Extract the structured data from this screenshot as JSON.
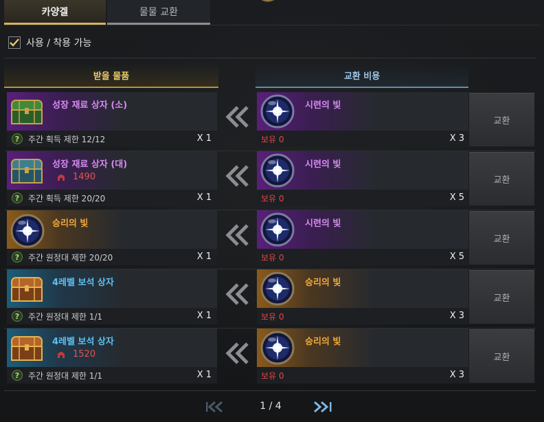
{
  "tabs": [
    {
      "label": "카양겔",
      "active": true
    },
    {
      "label": "물물 교환",
      "active": false
    }
  ],
  "filter": {
    "label": "사용 / 착용 가능",
    "checked": true
  },
  "headers": {
    "receive": "받을 물품",
    "cost": "교환 비용"
  },
  "rows": [
    {
      "item": {
        "name": "성장 재료 상자 (소)",
        "color": "purple",
        "icon": "green-chest-icon"
      },
      "limit": "주간 획득 제한 12/12",
      "qty": "X 1",
      "cost": {
        "name": "시련의 빛",
        "color": "purple",
        "icon": "trial-light-orb-icon",
        "owned": "보유 0",
        "qty": "X 3"
      },
      "button": "교환"
    },
    {
      "item": {
        "name": "성장 재료 상자 (대)",
        "color": "purple",
        "icon": "teal-chest-icon",
        "price": "1490"
      },
      "limit": "주간 획득 제한 20/20",
      "qty": "X 1",
      "cost": {
        "name": "시련의 빛",
        "color": "purple",
        "icon": "trial-light-orb-icon",
        "owned": "보유 0",
        "qty": "X 5"
      },
      "button": "교환"
    },
    {
      "item": {
        "name": "승리의 빛",
        "color": "orange",
        "icon": "victory-light-orb-icon"
      },
      "limit": "주간 원정대 제한 20/20",
      "qty": "X 1",
      "cost": {
        "name": "시련의 빛",
        "color": "purple",
        "icon": "trial-light-orb-icon",
        "owned": "보유 0",
        "qty": "X 5"
      },
      "button": "교환"
    },
    {
      "item": {
        "name": "4레벨 보석 상자",
        "color": "blue",
        "icon": "gem-chest-icon"
      },
      "limit": "주간 원정대 제한 1/1",
      "qty": "X 1",
      "cost": {
        "name": "승리의 빛",
        "color": "orange",
        "icon": "victory-light-orb-icon",
        "owned": "보유 0",
        "qty": "X 3"
      },
      "button": "교환"
    },
    {
      "item": {
        "name": "4레벨 보석 상자",
        "color": "blue",
        "icon": "gem-chest-icon",
        "price": "1520"
      },
      "limit": "주간 원정대 제한 1/1",
      "qty": "X 1",
      "cost": {
        "name": "승리의 빛",
        "color": "orange",
        "icon": "victory-light-orb-icon",
        "owned": "보유 0",
        "qty": "X 3"
      },
      "button": "교환"
    }
  ],
  "pager": {
    "text": "1 / 4"
  },
  "colors": {
    "gold_accent": "#d6b35b",
    "purple": "#d58af0",
    "orange": "#f0a93a",
    "blue": "#5ec0f0",
    "owned_red": "#e04848"
  }
}
